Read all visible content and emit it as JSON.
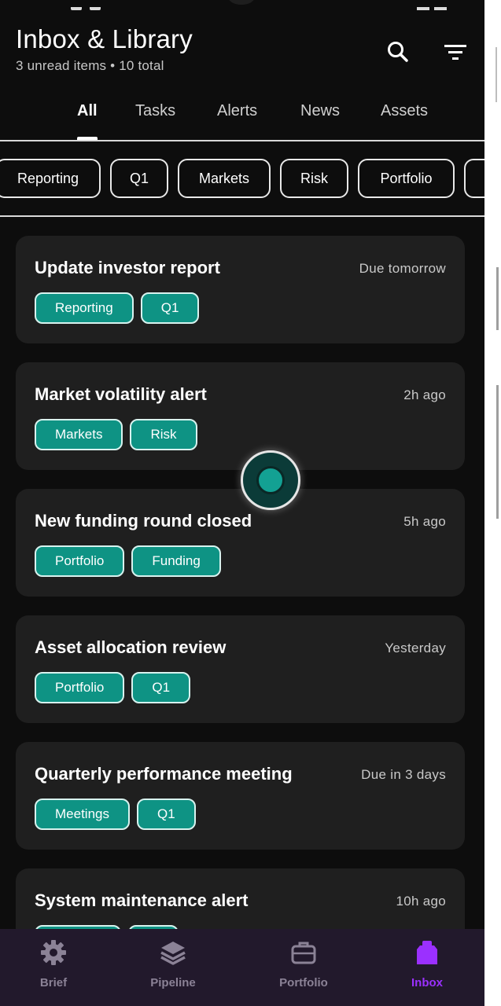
{
  "header": {
    "title": "Inbox & Library",
    "subtitle": "3 unread items • 10 total",
    "search_icon": "search-icon",
    "filter_icon": "filter-icon"
  },
  "tabs": [
    {
      "label": "All",
      "active": true
    },
    {
      "label": "Tasks",
      "active": false
    },
    {
      "label": "Alerts",
      "active": false
    },
    {
      "label": "News",
      "active": false
    },
    {
      "label": "Assets",
      "active": false
    }
  ],
  "filter_chips": [
    "Reporting",
    "Q1",
    "Markets",
    "Risk",
    "Portfolio",
    ""
  ],
  "items": [
    {
      "title": "Update investor report",
      "time": "Due tomorrow",
      "tags": [
        "Reporting",
        "Q1"
      ]
    },
    {
      "title": "Market volatility alert",
      "time": "2h ago",
      "tags": [
        "Markets",
        "Risk"
      ]
    },
    {
      "title": "New funding round closed",
      "time": "5h ago",
      "tags": [
        "Portfolio",
        "Funding"
      ]
    },
    {
      "title": "Asset allocation review",
      "time": "Yesterday",
      "tags": [
        "Portfolio",
        "Q1"
      ]
    },
    {
      "title": "Quarterly performance meeting",
      "time": "Due in 3 days",
      "tags": [
        "Meetings",
        "Q1"
      ]
    },
    {
      "title": "System maintenance alert",
      "time": "10h ago",
      "tags": []
    }
  ],
  "bottom_nav": [
    {
      "label": "Brief",
      "icon": "gear-icon",
      "active": false
    },
    {
      "label": "Pipeline",
      "icon": "layers-icon",
      "active": false
    },
    {
      "label": "Portfolio",
      "icon": "briefcase-icon",
      "active": false
    },
    {
      "label": "Inbox",
      "icon": "inbox-icon",
      "active": true
    }
  ],
  "colors": {
    "background": "#0d0d0d",
    "card": "#1f1f1f",
    "tag": "#0e9384",
    "nav_background": "#22192c",
    "nav_active": "#9b30ff",
    "nav_inactive": "#8b8296"
  }
}
